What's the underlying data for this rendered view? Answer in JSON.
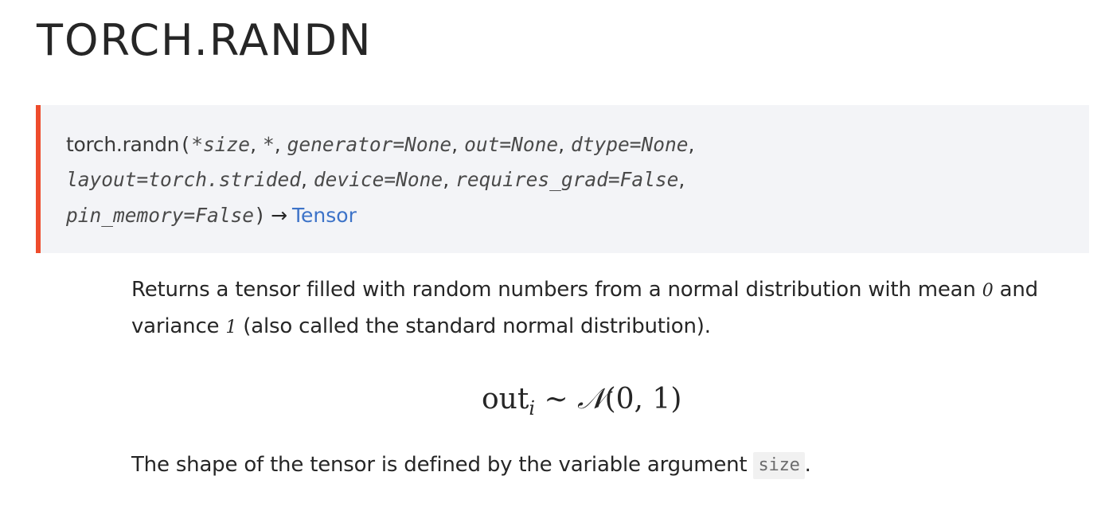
{
  "title": "TORCH.RANDN",
  "signature": {
    "function_name": "torch.randn",
    "open_paren": "(",
    "close_paren": ")",
    "params_line1": [
      "*size",
      "*",
      "generator=None",
      "out=None",
      "dtype=None"
    ],
    "params_line2": [
      "layout=torch.strided",
      "device=None",
      "requires_grad=False"
    ],
    "params_line3": [
      "pin_memory=False"
    ],
    "separator": ",",
    "arrow": "→",
    "return_type": "Tensor"
  },
  "description": {
    "p1_before_mean": "Returns a tensor filled with random numbers from a normal distribution with mean ",
    "mean_value": "0",
    "p1_and": " and variance ",
    "variance_value": "1",
    "p1_after": " (also called the standard normal distribution).",
    "p2_before": "The shape of the tensor is defined by the variable argument ",
    "p2_code": "size",
    "p2_after": "."
  },
  "formula": {
    "lhs": "out",
    "subscript": "i",
    "relation": " ∼ ",
    "dist": "𝒩",
    "args": "(0, 1)"
  },
  "colors": {
    "accent_border": "#ee4c2c",
    "signature_bg": "#f3f4f7",
    "link": "#3d73c8",
    "text": "#262626"
  }
}
